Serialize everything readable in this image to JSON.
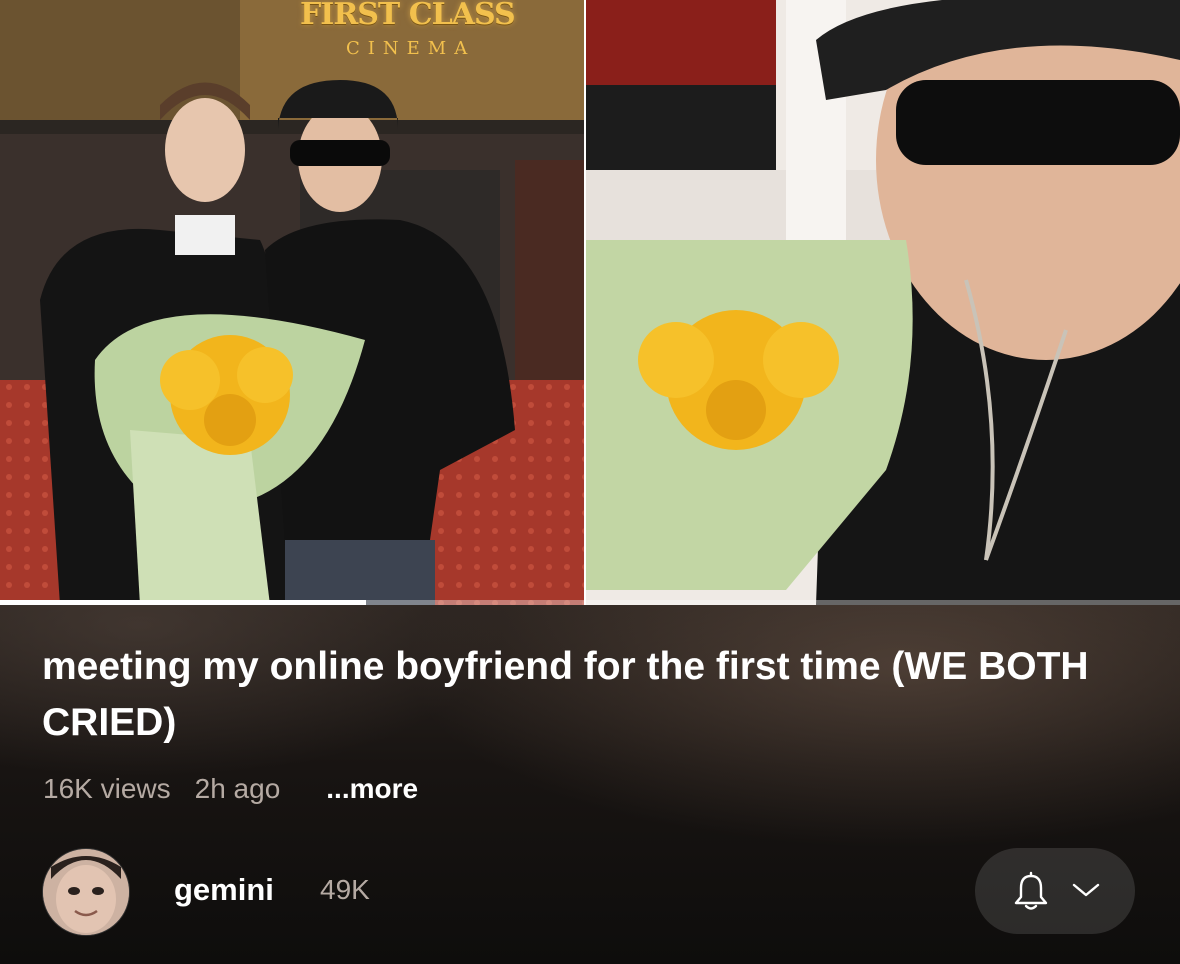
{
  "video": {
    "progress_fraction": 0.31,
    "left_photo_sign_title": "FIRST CLASS",
    "left_photo_sign_subtitle": "CINEMA"
  },
  "title": "meeting my online boyfriend for the first time (WE BOTH CRIED)",
  "meta": {
    "views": "16K views",
    "ago": "2h ago",
    "more": "...more"
  },
  "channel": {
    "name": "gemini",
    "subscribers": "49K"
  },
  "icons": {
    "bell": "bell-icon",
    "chevron": "chevron-down-icon"
  },
  "colors": {
    "background": "#0f0f0f",
    "title_text": "#ffffff",
    "secondary_text": "#b5aaa3",
    "seek_track": "rgba(255,255,255,0.35)",
    "seek_fill": "#ffffff"
  }
}
